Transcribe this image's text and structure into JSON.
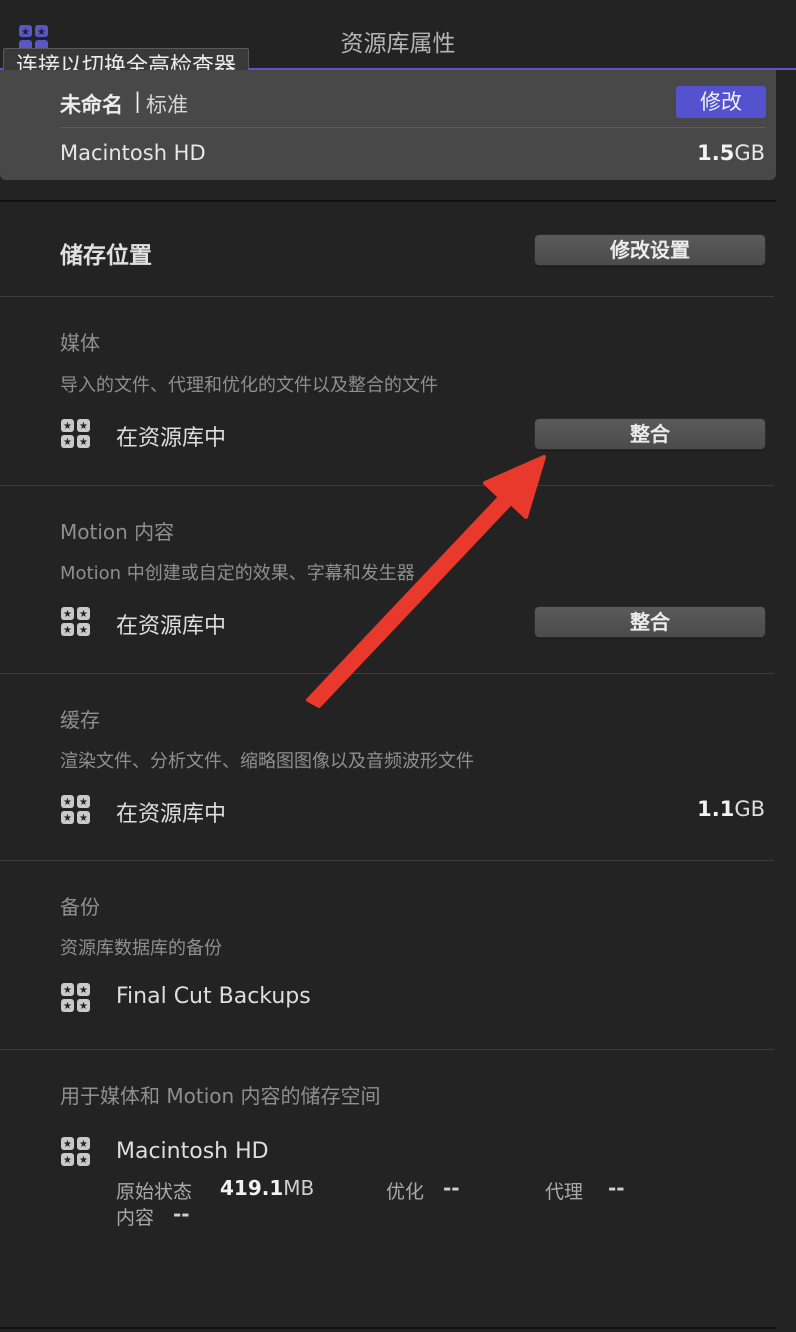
{
  "header": {
    "title": "资源库属性"
  },
  "tooltip": {
    "text": "连接以切换全高检查器"
  },
  "library": {
    "name": "未命名",
    "separator": "|",
    "type": "标准",
    "modify_label": "修改",
    "disk_name": "Macintosh HD",
    "disk_size_number": "1.5",
    "disk_size_unit": "GB"
  },
  "storage": {
    "title": "储存位置",
    "modify_settings_label": "修改设置"
  },
  "media": {
    "title": "媒体",
    "description": "导入的文件、代理和优化的文件以及整合的文件",
    "location": "在资源库中",
    "consolidate_label": "整合"
  },
  "motion": {
    "title": "Motion 内容",
    "description": "Motion 中创建或自定的效果、字幕和发生器",
    "location": "在资源库中",
    "consolidate_label": "整合"
  },
  "cache": {
    "title": "缓存",
    "description": "渲染文件、分析文件、缩略图图像以及音频波形文件",
    "location": "在资源库中",
    "size_number": "1.1",
    "size_unit": "GB"
  },
  "backup": {
    "title": "备份",
    "description": "资源库数据库的备份",
    "location": "Final Cut Backups"
  },
  "space": {
    "title": "用于媒体和 Motion 内容的储存空间",
    "disk_name": "Macintosh HD",
    "original_label": "原始状态",
    "original_number": "419.1",
    "original_unit": "MB",
    "optimized_label": "优化",
    "optimized_value": "--",
    "proxy_label": "代理",
    "proxy_value": "--",
    "content_label": "内容",
    "content_value": "--"
  },
  "colors": {
    "accent": "#5452cf",
    "annotation_arrow": "#e8392c",
    "background": "#232323"
  },
  "icons": [
    "app-icon",
    "library-icon",
    "annotation-arrow"
  ]
}
